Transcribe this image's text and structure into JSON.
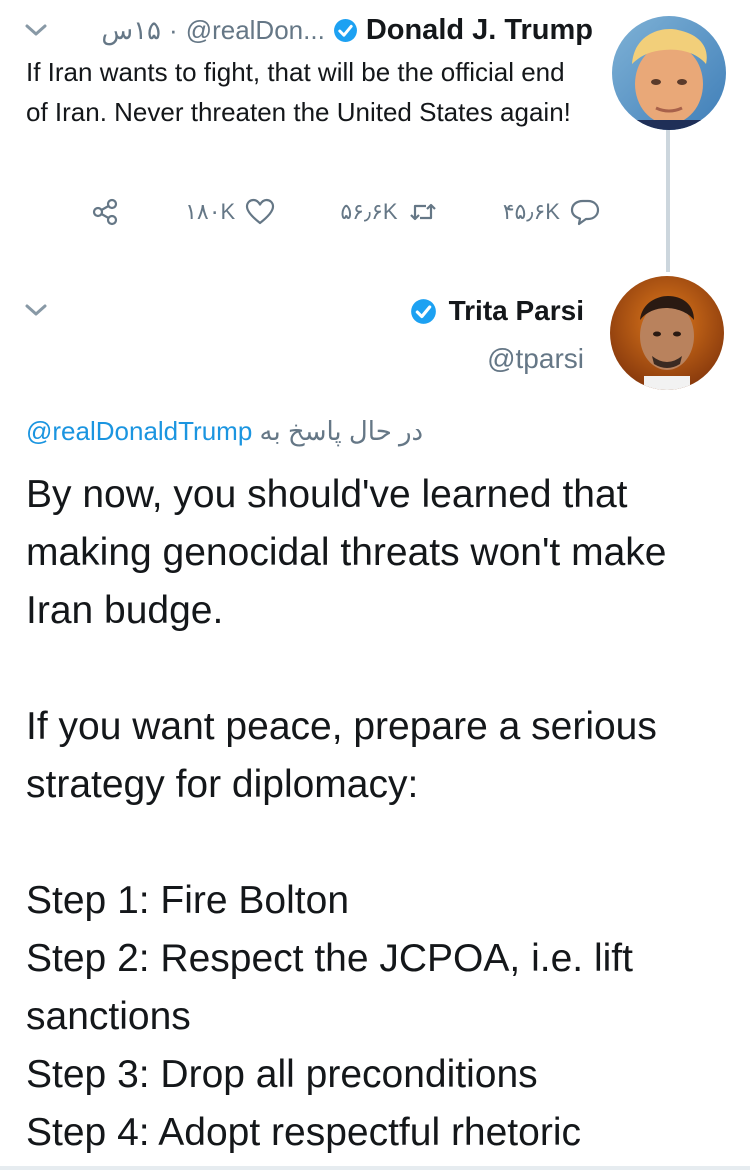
{
  "first_tweet": {
    "name": "Donald J. Trump",
    "handle": "@realDon...",
    "separator": "·",
    "time": "۱۵س",
    "text": "If Iran wants to fight, that will be the official end of Iran. Never threaten the United States again!",
    "actions": {
      "reply_count": "۴۵٫۶K",
      "retweet_count": "۵۶٫۶K",
      "like_count": "۱۸۰K"
    }
  },
  "reply_tweet": {
    "name": "Trita Parsi",
    "handle": "@tparsi",
    "replying_to_prefix": "در حال پاسخ به",
    "replying_to_mention": "@realDonaldTrump",
    "text": "By now, you should've learned that making genocidal threats won't make Iran budge.\n\nIf you want peace, prepare a serious strategy for diplomacy:\n\nStep 1: Fire Bolton\nStep 2: Respect the JCPOA, i.e. lift sanctions\nStep 3: Drop all preconditions\nStep 4: Adopt respectful rhetoric"
  },
  "colors": {
    "verified_blue": "#1da1f2",
    "secondary_text": "#657786",
    "link": "#1b95e0",
    "thread_line": "#ccd6dd"
  }
}
